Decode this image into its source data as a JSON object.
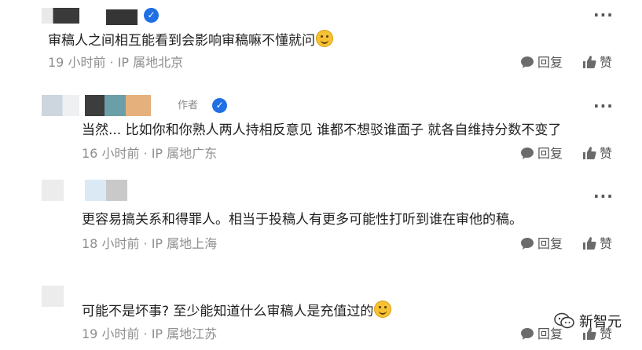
{
  "comments": [
    {
      "text": "审稿人之间相互能看到会影响审稿嘛不懂就问",
      "has_emoji": true,
      "emoji": "thinking-emoji",
      "meta": "19 小时前 · IP 属地北京",
      "reply_label": "回复",
      "like_label": "赞",
      "author_tag": "",
      "verified": true
    },
    {
      "text": "当然... 比如你和你熟人两人持相反意见 谁都不想驳谁面子 就各自维持分数不变了",
      "meta": "16 小时前 · IP 属地广东",
      "reply_label": "回复",
      "like_label": "赞",
      "author_tag": "作者",
      "verified": true
    },
    {
      "text": "更容易搞关系和得罪人。相当于投稿人有更多可能性打听到谁在审他的稿。",
      "meta": "18 小时前 · IP 属地上海",
      "reply_label": "回复",
      "like_label": "赞"
    },
    {
      "text": "可能不是坏事? 至少能知道什么审稿人是充值过的",
      "has_emoji": true,
      "emoji": "grinning-emoji",
      "meta": "19 小时前 · IP 属地江苏",
      "reply_label": "回复",
      "like_label": "赞"
    }
  ],
  "watermark": {
    "label": "新智元",
    "icon": "wechat-icon"
  },
  "colors": {
    "verified": "#1f6fe5",
    "meta": "#8e8e8e",
    "emoji": "#f6c233"
  }
}
